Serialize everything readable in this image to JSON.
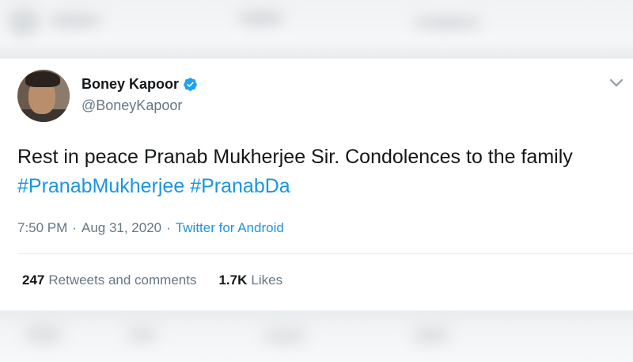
{
  "tweet": {
    "author": {
      "display_name": "Boney Kapoor",
      "handle": "@BoneyKapoor",
      "verified": true
    },
    "text_plain": "Rest in peace Pranab Mukherjee Sir. Condolences to the family",
    "hashtags": [
      "#PranabMukherjee",
      "#PranabDa"
    ],
    "time": "7:50 PM",
    "date": "Aug 31, 2020",
    "separator": "·",
    "source": "Twitter for Android",
    "stats": {
      "retweets_count": "247",
      "retweets_label": "Retweets and comments",
      "likes_count": "1.7K",
      "likes_label": "Likes"
    }
  },
  "colors": {
    "link_blue": "#1b95e0",
    "text_dark": "#14171a",
    "text_gray": "#657786",
    "divider": "#e1e8ed"
  },
  "icons": {
    "verified": "verified-badge-icon",
    "menu": "chevron-down-icon"
  }
}
